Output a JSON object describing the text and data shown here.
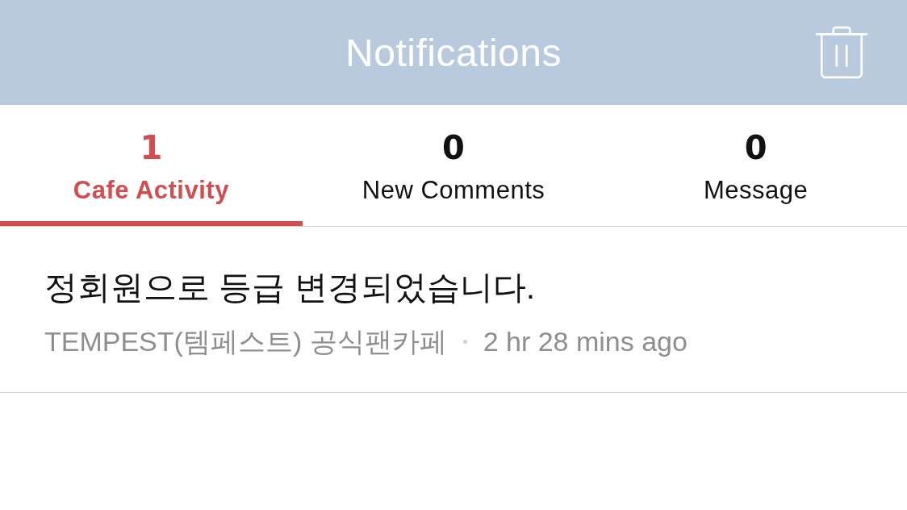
{
  "header": {
    "title": "Notifications"
  },
  "tabs": [
    {
      "count": "1",
      "label": "Cafe Activity",
      "selected": true
    },
    {
      "count": "0",
      "label": "New Comments",
      "selected": false
    },
    {
      "count": "0",
      "label": "Message",
      "selected": false
    }
  ],
  "notifications": [
    {
      "message": "정회원으로 등급 변경되었습니다.",
      "source": "TEMPEST(템페스트) 공식팬카페",
      "time": "2 hr 28 mins ago"
    }
  ]
}
